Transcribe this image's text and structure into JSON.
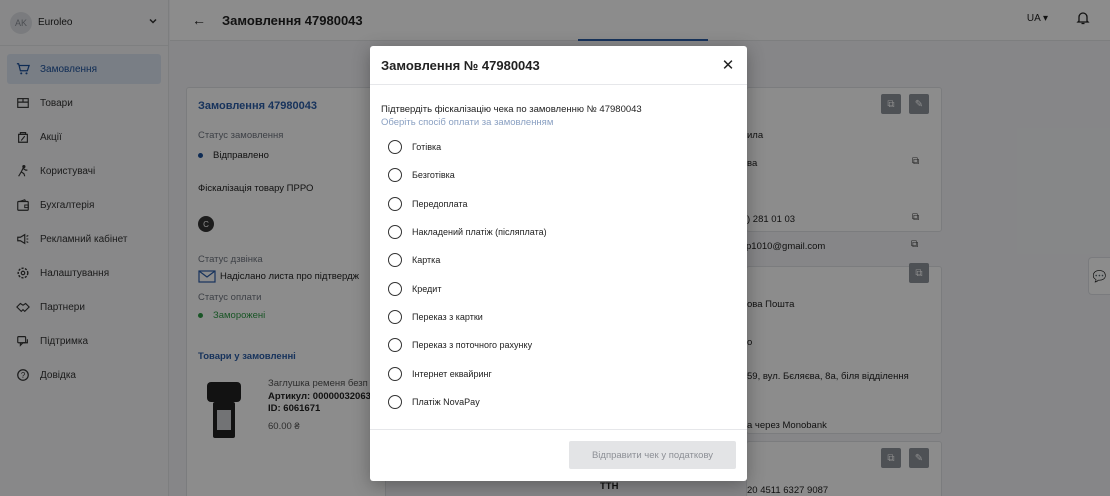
{
  "company": {
    "avatar": "AK",
    "name": "Euroleo"
  },
  "sidebar": {
    "items": [
      {
        "label": "Замовлення",
        "icon": "cart-icon",
        "active": true
      },
      {
        "label": "Товари",
        "icon": "box-icon"
      },
      {
        "label": "Акції",
        "icon": "discount-icon"
      },
      {
        "label": "Користувачі",
        "icon": "users-icon"
      },
      {
        "label": "Бухгалтерія",
        "icon": "wallet-icon"
      },
      {
        "label": "Рекламний кабінет",
        "icon": "megaphone-icon"
      },
      {
        "label": "Налаштування",
        "icon": "gear-icon"
      },
      {
        "label": "Партнери",
        "icon": "handshake-icon"
      },
      {
        "label": "Підтримка",
        "icon": "chat-icon"
      },
      {
        "label": "Довідка",
        "icon": "help-icon"
      }
    ]
  },
  "header": {
    "back": "←",
    "title": "Замовлення 47980043",
    "lang": "UA"
  },
  "order_card": {
    "title": "Замовлення 47980043",
    "status_label": "Статус замовлення",
    "status_value": "Відправлено",
    "fiscal_label": "Фіскалізація товару ПРРО",
    "fiscal_badge": "C",
    "call_label": "Статус дзвінка",
    "call_value": "Надіслано листа про підтвердж",
    "payment_label": "Статус оплати",
    "payment_value": "Заморожені",
    "products_title": "Товари у замовленні",
    "product_name": "Заглушка ременя безп",
    "product_sku": "Артикул: 00000032063",
    "product_id": "ID: 6061671",
    "product_price": "60.00 ₴"
  },
  "right_card": {
    "t1": "ила",
    "t2": "ва",
    "t3": ") 281 01 03",
    "t4": "p1010@gmail.com",
    "t5": "ова Пошта",
    "t6": "о",
    "t7": "59, вул. Бєляєва, 8а, біля відділення",
    "t8": "а через Monobank",
    "ttn_label": "ТТН",
    "ttn_value": "20 4511 6327 9087"
  },
  "modal": {
    "title": "Замовлення № 47980043",
    "prompt": "Підтвердіть фіскалізацію чека по замовленню № 47980043",
    "hint": "Оберіть спосіб оплати за замовленням",
    "options": [
      "Готівка",
      "Безготівка",
      "Передоплата",
      "Накладений платіж (післяплата)",
      "Картка",
      "Кредит",
      "Переказ з картки",
      "Переказ з поточного рахунку",
      "Інтернет еквайринг",
      "Платіж NovaPay"
    ],
    "send_label": "Відправити чек у податкову"
  },
  "colors": {
    "accent": "#2b5ea8",
    "active_nav_bg": "#dde6f3",
    "success": "#2e9b45",
    "status_dot": "#1a4f9a"
  }
}
